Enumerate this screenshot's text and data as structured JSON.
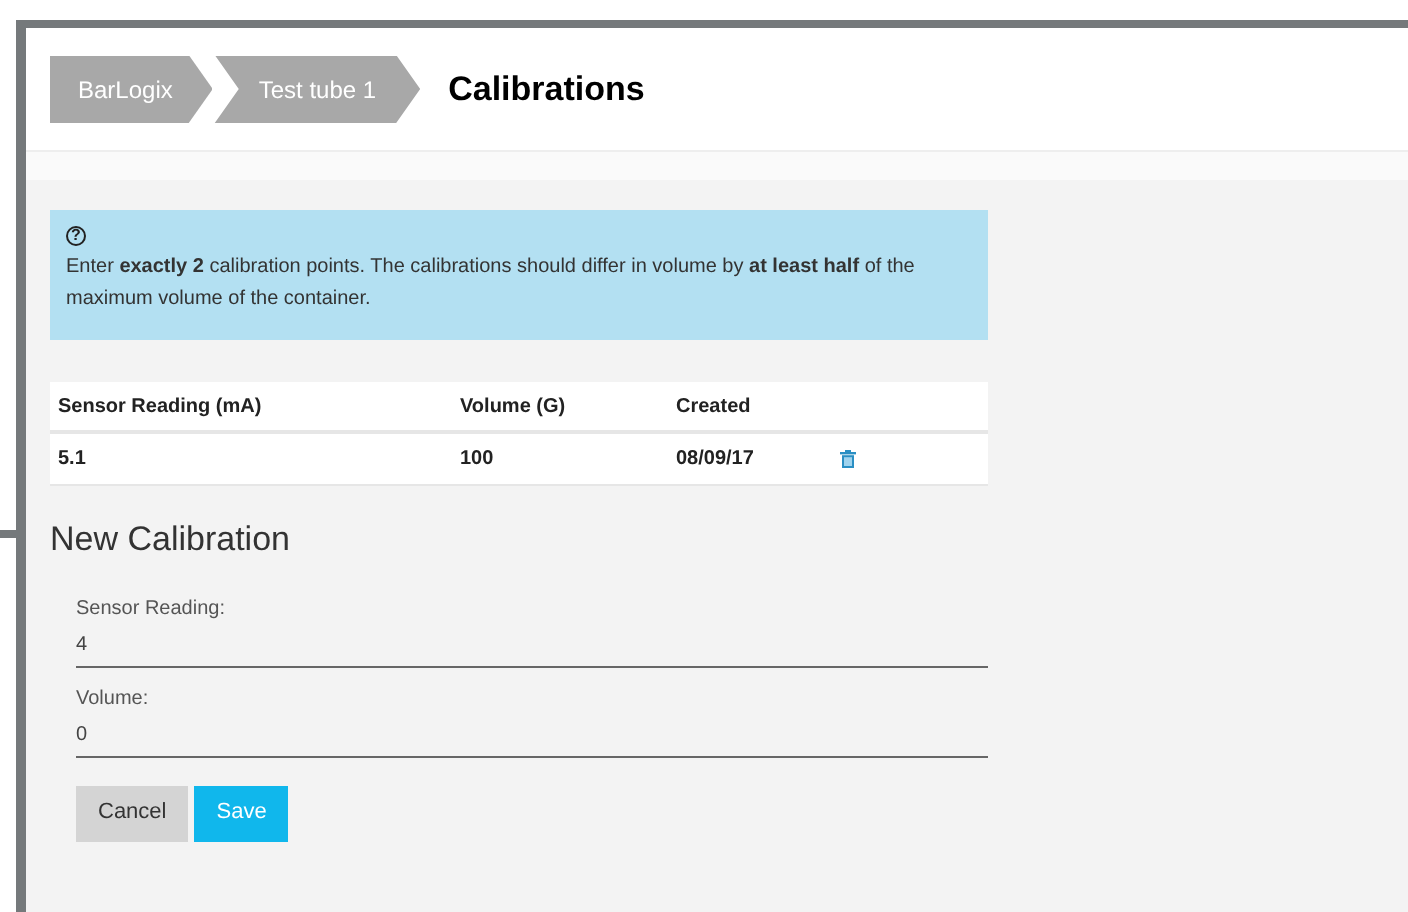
{
  "breadcrumbs": [
    {
      "label": "BarLogix"
    },
    {
      "label": "Test tube 1"
    }
  ],
  "page_title": "Calibrations",
  "info": {
    "icon": "?",
    "text": "Enter **exactly 2** calibration points. The calibrations should differ in volume by **at least half** of the maximum volume of the container."
  },
  "table": {
    "columns": [
      "Sensor Reading (mA)",
      "Volume (G)",
      "Created"
    ],
    "rows": [
      {
        "cells": [
          "5.1",
          "100",
          "08/09/17"
        ]
      }
    ]
  },
  "form": {
    "title": "New Calibration",
    "fields": [
      {
        "label": "Sensor Reading:",
        "value": "4"
      },
      {
        "label": "Volume:",
        "value": "0"
      }
    ],
    "buttons": [
      {
        "label": "Cancel",
        "kind": "secondary"
      },
      {
        "label": "Save",
        "kind": "primary"
      }
    ]
  }
}
